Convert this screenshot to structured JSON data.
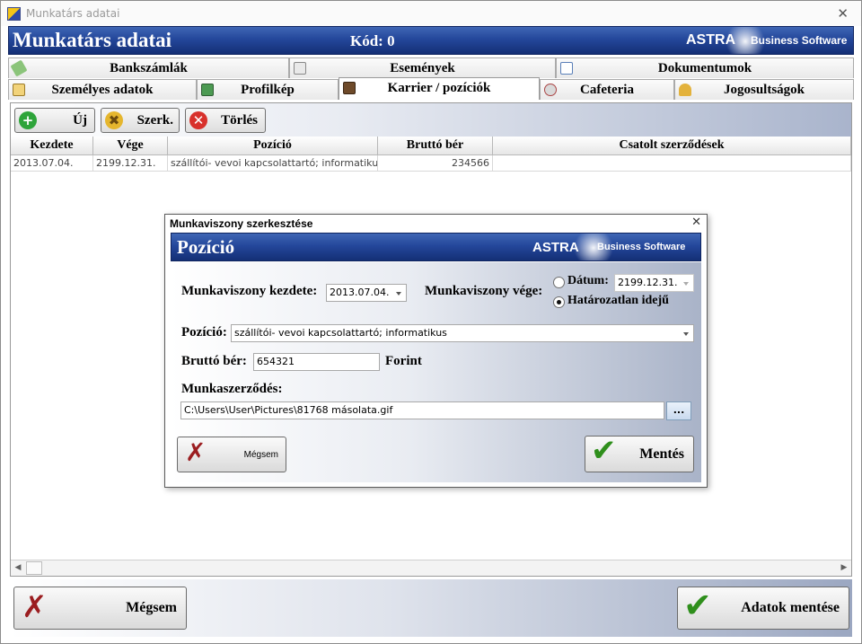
{
  "window": {
    "title": "Munkatárs adatai",
    "close_glyph": "✕"
  },
  "header": {
    "title": "Munkatárs adatai",
    "code": "Kód: 0",
    "brand": "ASTRA",
    "brand_suffix": "Business Software"
  },
  "tabs_row1": [
    {
      "label": "Bankszámlák",
      "icon": "money-icon"
    },
    {
      "label": "Események",
      "icon": "calendar-icon"
    },
    {
      "label": "Dokumentumok",
      "icon": "documents-icon"
    }
  ],
  "tabs_row2": [
    {
      "label": "Személyes adatok",
      "icon": "id-card-icon"
    },
    {
      "label": "Profilkép",
      "icon": "picture-icon"
    },
    {
      "label": "Karrier / pozíciók",
      "icon": "career-icon",
      "active": true
    },
    {
      "label": "Cafeteria",
      "icon": "coffee-icon"
    },
    {
      "label": "Jogosultságok",
      "icon": "key-icon"
    }
  ],
  "toolbar": {
    "new_label": "Új",
    "edit_label": "Szerk.",
    "delete_label": "Törlés"
  },
  "grid": {
    "columns": [
      "Kezdete",
      "Vége",
      "Pozíció",
      "Bruttó bér",
      "Csatolt szerződések"
    ],
    "rows": [
      [
        "2013.07.04.",
        "2199.12.31.",
        "szállítói- vevoi kapcsolattartó; informatikus",
        "234566",
        ""
      ]
    ]
  },
  "scrollbar": {
    "left_arrow": "◀",
    "right_arrow": "▶"
  },
  "bottom": {
    "cancel_label": "Mégsem",
    "save_label": "Adatok mentése"
  },
  "dialog": {
    "title": "Munkaviszony szerkesztése",
    "close_glyph": "✕",
    "header_title": "Pozíció",
    "brand": "ASTRA",
    "brand_suffix": "Business Software",
    "start_label": "Munkaviszony kezdete:",
    "start_value": "2013.07.04.",
    "end_label": "Munkaviszony vége:",
    "date_option_label": "Dátum:",
    "date_value": "2199.12.31.",
    "indefinite_label": "Határozatlan idejű",
    "position_label": "Pozíció:",
    "position_value": "szállítói- vevoi kapcsolattartó; informatikus",
    "salary_label": "Bruttó bér:",
    "salary_value": "654321",
    "currency_label": "Forint",
    "contract_label": "Munkaszerződés:",
    "contract_value": "C:\\Users\\User\\Pictures\\81768 másolata.gif",
    "browse_label": "...",
    "cancel_label": "Mégsem",
    "save_label": "Mentés"
  },
  "colors": {
    "banner_blue": "#24479b",
    "cancel_red": "#9b1d20",
    "save_green": "#2f8f1c"
  }
}
